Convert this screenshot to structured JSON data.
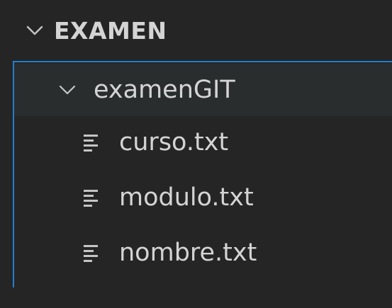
{
  "explorer": {
    "section": {
      "title": "EXAMEN",
      "chevron_icon": "chevron-down-icon",
      "expanded": true
    },
    "folder": {
      "label": "examenGIT",
      "chevron_icon": "chevron-down-icon",
      "expanded": true
    },
    "files": [
      {
        "label": "curso.txt",
        "icon": "text-file-icon"
      },
      {
        "label": "modulo.txt",
        "icon": "text-file-icon"
      },
      {
        "label": "nombre.txt",
        "icon": "text-file-icon"
      }
    ]
  },
  "colors": {
    "background": "#252526",
    "hover_row": "#2a2d2e",
    "focus_border": "#1f7fcf",
    "text": "#d4d4d4"
  }
}
